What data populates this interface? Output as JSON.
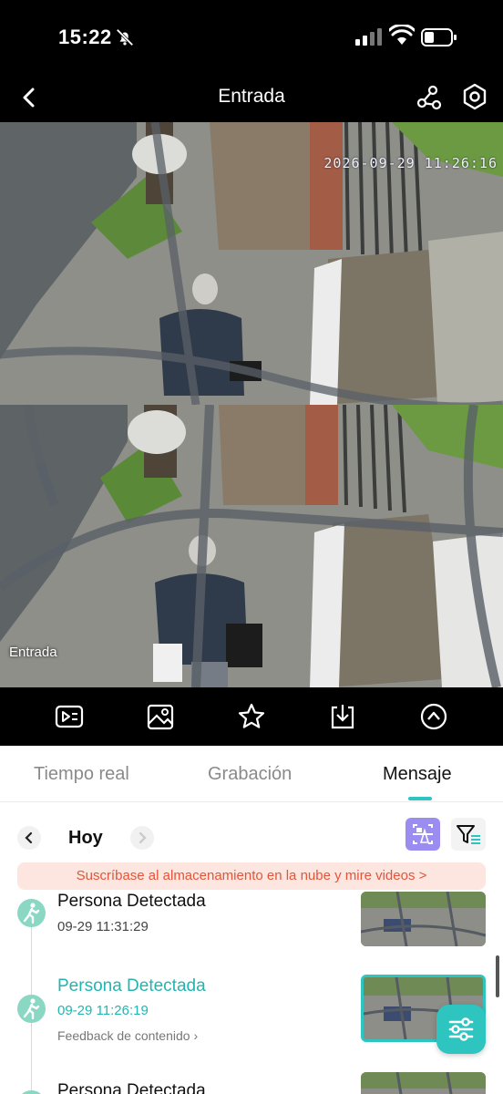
{
  "status_bar": {
    "time": "15:22"
  },
  "nav": {
    "title": "Entrada"
  },
  "feed": {
    "timestamp": "2026-09-29 11:26:16",
    "camera_label": "Entrada"
  },
  "tabs": [
    {
      "label": "Tiempo real",
      "active": false
    },
    {
      "label": "Grabación",
      "active": false
    },
    {
      "label": "Mensaje",
      "active": true
    }
  ],
  "date_row": {
    "label": "Hoy"
  },
  "banner": {
    "text": "Suscríbase al almacenamiento en la nube y mire videos >"
  },
  "events": [
    {
      "title": "Persona Detectada",
      "time": "09-29 11:31:29",
      "highlighted": false
    },
    {
      "title": "Persona Detectada",
      "time": "09-29 11:26:19",
      "feedback": "Feedback de contenido",
      "highlighted": true
    },
    {
      "title": "Persona Detectada",
      "highlighted": false
    }
  ],
  "icons": {
    "status": [
      "bell-off-icon",
      "signal-icon",
      "wifi-icon",
      "battery-icon"
    ],
    "nav": [
      "back-arrow-icon",
      "share-icon",
      "settings-icon"
    ],
    "controls": [
      "playback-icon",
      "snapshot-icon",
      "favorite-star-icon",
      "download-icon",
      "collapse-up-icon"
    ],
    "list": [
      "person-walking-icon",
      "ai-search-icon",
      "filter-icon",
      "adjust-sliders-icon"
    ]
  },
  "colors": {
    "accent": "#2ec4c0",
    "ai_button": "#9a8cf0",
    "banner_text": "#e2553a",
    "banner_bg": "#fde6df"
  }
}
